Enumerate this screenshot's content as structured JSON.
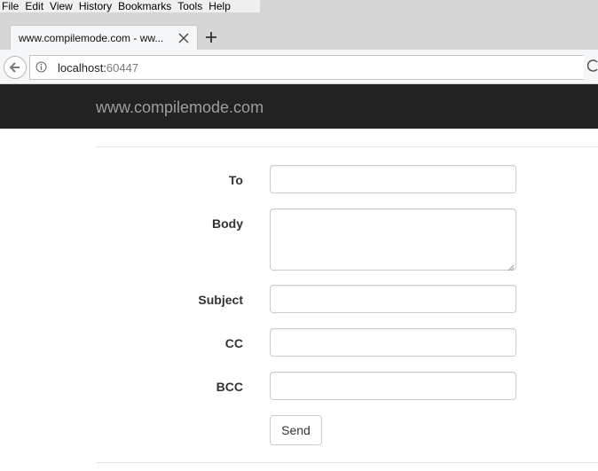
{
  "browser": {
    "menu": [
      "File",
      "Edit",
      "View",
      "History",
      "Bookmarks",
      "Tools",
      "Help"
    ],
    "tab_title": "www.compilemode.com - ww...",
    "url_host": "localhost:",
    "url_port": "60447"
  },
  "site": {
    "brand": "www.compilemode.com"
  },
  "form": {
    "to_label": "To",
    "body_label": "Body",
    "subject_label": "Subject",
    "cc_label": "CC",
    "bcc_label": "BCC",
    "to_value": "",
    "body_value": "",
    "subject_value": "",
    "cc_value": "",
    "bcc_value": "",
    "send_label": "Send"
  }
}
